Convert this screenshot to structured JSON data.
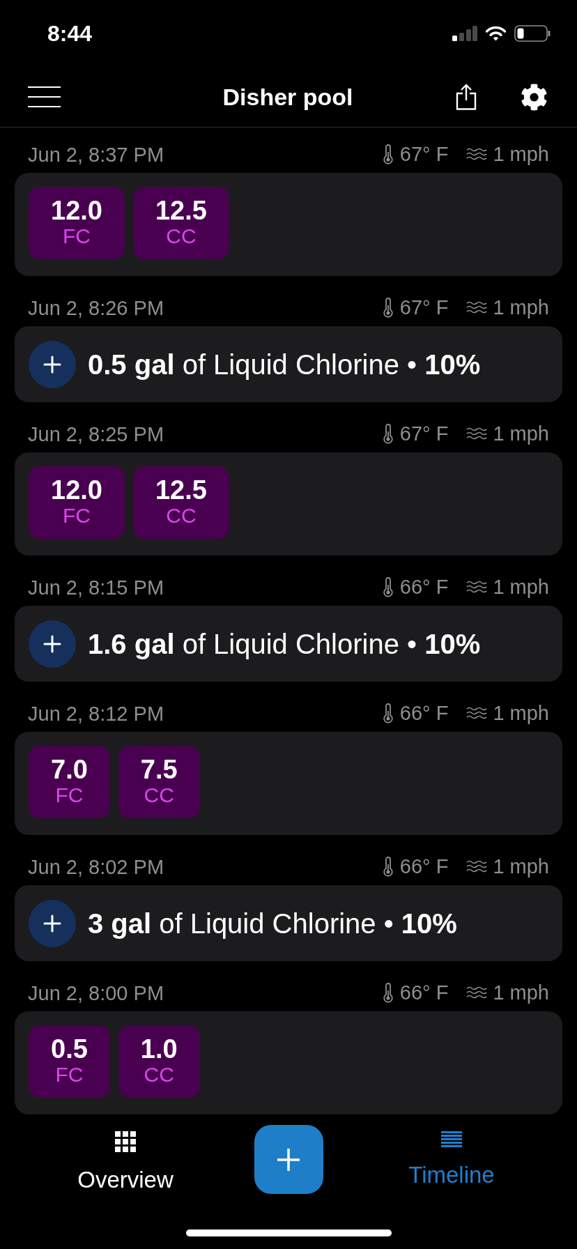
{
  "status_bar": {
    "time": "8:44"
  },
  "header": {
    "title": "Disher pool"
  },
  "timeline": [
    {
      "kind": "reading",
      "date": "Jun 2, 8:37 PM",
      "temperature": "67° F",
      "wind": "1 mph",
      "readings": [
        {
          "value": "12.0",
          "label": "FC"
        },
        {
          "value": "12.5",
          "label": "CC"
        }
      ]
    },
    {
      "kind": "dose",
      "date": "Jun 2, 8:26 PM",
      "temperature": "67° F",
      "wind": "1 mph",
      "text": "**0.5 gal** of Liquid Chlorine • **10%**"
    },
    {
      "kind": "reading",
      "date": "Jun 2, 8:25 PM",
      "temperature": "67° F",
      "wind": "1 mph",
      "readings": [
        {
          "value": "12.0",
          "label": "FC"
        },
        {
          "value": "12.5",
          "label": "CC"
        }
      ]
    },
    {
      "kind": "dose",
      "date": "Jun 2, 8:15 PM",
      "temperature": "66° F",
      "wind": "1 mph",
      "text": "**1.6 gal** of Liquid Chlorine • **10%**"
    },
    {
      "kind": "reading",
      "date": "Jun 2, 8:12 PM",
      "temperature": "66° F",
      "wind": "1 mph",
      "readings": [
        {
          "value": "7.0",
          "label": "FC"
        },
        {
          "value": "7.5",
          "label": "CC"
        }
      ]
    },
    {
      "kind": "dose",
      "date": "Jun 2, 8:02 PM",
      "temperature": "66° F",
      "wind": "1 mph",
      "text": "**3 gal** of Liquid Chlorine • **10%**"
    },
    {
      "kind": "reading",
      "date": "Jun 2, 8:00 PM",
      "temperature": "66° F",
      "wind": "1 mph",
      "readings": [
        {
          "value": "0.5",
          "label": "FC"
        },
        {
          "value": "1.0",
          "label": "CC"
        }
      ]
    }
  ],
  "tab_bar": {
    "tabs": [
      {
        "kind": "grid",
        "label": "Overview",
        "selected": false
      },
      {
        "kind": "list",
        "label": "Timeline",
        "selected": true
      }
    ]
  }
}
